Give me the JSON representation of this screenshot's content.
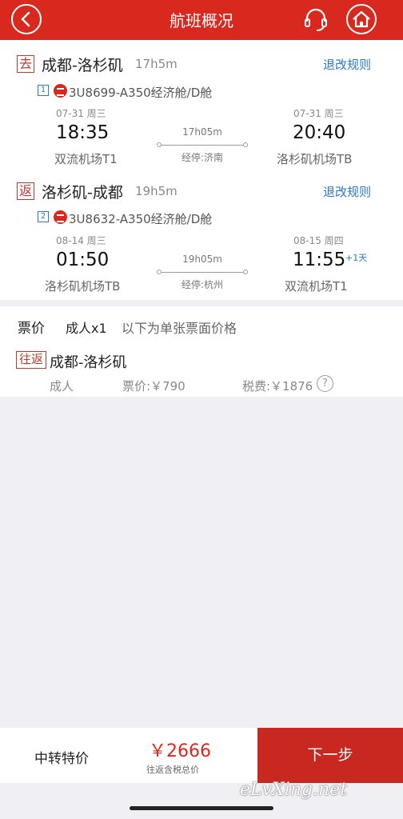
{
  "header": {
    "title": "航班概况",
    "back_icon": "chevron-left-icon",
    "service_icon": "headset-icon",
    "home_icon": "home-icon"
  },
  "outbound": {
    "tag": "去",
    "route": "成都-洛杉矶",
    "duration": "17h5m",
    "rules": "退改规则",
    "seq": "1",
    "flight_info": "3U8699-A350经济舱/D舱",
    "dep_date": "07-31 周三",
    "dep_time": "18:35",
    "dep_airport": "双流机场T1",
    "mid_duration": "17h05m",
    "stop": "经停:济南",
    "arr_date": "07-31 周三",
    "arr_time": "20:40",
    "arr_airport": "洛杉矶机场TB"
  },
  "return": {
    "tag": "返",
    "route": "洛杉矶-成都",
    "duration": "19h5m",
    "rules": "退改规则",
    "seq": "2",
    "flight_info": "3U8632-A350经济舱/D舱",
    "dep_date": "08-14 周三",
    "dep_time": "01:50",
    "dep_airport": "洛杉矶机场TB",
    "mid_duration": "19h05m",
    "stop": "经停:杭州",
    "arr_date": "08-15 周四",
    "arr_time": "11:55",
    "arr_extra": "+1天",
    "arr_airport": "双流机场T1"
  },
  "pricing": {
    "title": "票价",
    "adults": "成人x1",
    "note": "以下为单张票面价格",
    "trip_tag": "往返",
    "route": "成都-洛杉矶",
    "passenger_type": "成人",
    "fare": "票价:￥790",
    "tax": "税费:￥1876",
    "help": "?"
  },
  "footer": {
    "transfer_label": "中转特价",
    "total": "￥2666",
    "total_note": "往返含税总价",
    "next_button": "下一步"
  },
  "watermark": "eLvXing.net",
  "colors": {
    "brand_red": "#d9281e",
    "link_blue": "#2a78c8",
    "background": "#efeff4"
  }
}
